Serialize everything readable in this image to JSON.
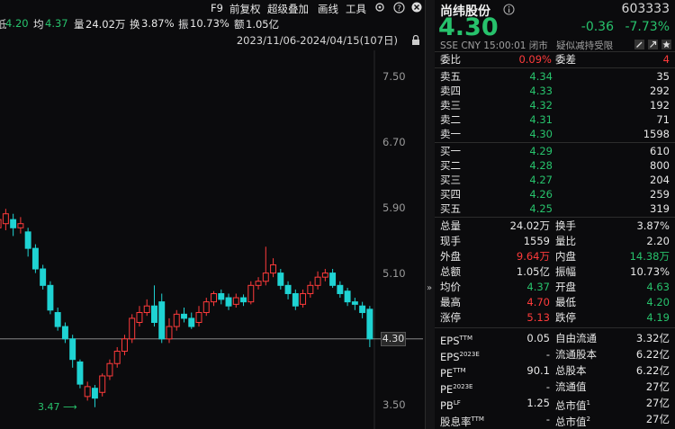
{
  "toolbar": {
    "f9": "F9",
    "adjust": "前复权",
    "overlay": "超级叠加",
    "draw": "画线",
    "tools": "工具",
    "settings_icon": "gear-icon",
    "help_icon": "help-icon",
    "close_icon": "close-icon"
  },
  "info": {
    "prefix": "低",
    "low": "4.20",
    "avg_label": "均",
    "avg": "4.37",
    "vol_label": "量",
    "vol": "24.02万",
    "turnover_label": "换",
    "turnover": "3.87%",
    "amp_label": "振",
    "amp": "10.73%",
    "amt_label": "额",
    "amt": "1.05亿"
  },
  "date_range": "2023/11/06-2024/04/15(107日)",
  "chart_data": {
    "type": "candlestick",
    "y_ticks": [
      "7.50",
      "6.70",
      "5.90",
      "5.10",
      "4.30",
      "3.50"
    ],
    "y_range": [
      3.5,
      7.5
    ],
    "current_price_tag": "4.30",
    "low_marker": "3.47",
    "candles": [
      {
        "o": 5.65,
        "c": 5.75,
        "h": 5.8,
        "l": 5.55
      },
      {
        "o": 5.7,
        "c": 5.82,
        "h": 5.88,
        "l": 5.62
      },
      {
        "o": 5.75,
        "c": 5.65,
        "h": 5.82,
        "l": 5.55
      },
      {
        "o": 5.65,
        "c": 5.7,
        "h": 5.78,
        "l": 5.58
      },
      {
        "o": 5.6,
        "c": 5.4,
        "h": 5.65,
        "l": 5.3
      },
      {
        "o": 5.4,
        "c": 5.15,
        "h": 5.45,
        "l": 5.1
      },
      {
        "o": 5.15,
        "c": 4.95,
        "h": 5.2,
        "l": 4.9
      },
      {
        "o": 4.95,
        "c": 4.65,
        "h": 5.0,
        "l": 4.6
      },
      {
        "o": 4.62,
        "c": 4.45,
        "h": 4.68,
        "l": 4.4
      },
      {
        "o": 4.45,
        "c": 4.3,
        "h": 4.5,
        "l": 4.25
      },
      {
        "o": 4.3,
        "c": 4.05,
        "h": 4.35,
        "l": 3.95
      },
      {
        "o": 4.02,
        "c": 3.75,
        "h": 4.05,
        "l": 3.7
      },
      {
        "o": 3.6,
        "c": 3.72,
        "h": 3.78,
        "l": 3.55
      },
      {
        "o": 3.7,
        "c": 3.58,
        "h": 3.74,
        "l": 3.47
      },
      {
        "o": 3.65,
        "c": 3.85,
        "h": 3.88,
        "l": 3.6
      },
      {
        "o": 3.85,
        "c": 4.0,
        "h": 4.05,
        "l": 3.8
      },
      {
        "o": 4.0,
        "c": 4.15,
        "h": 4.2,
        "l": 3.95
      },
      {
        "o": 4.15,
        "c": 4.3,
        "h": 4.35,
        "l": 4.1
      },
      {
        "o": 4.3,
        "c": 4.55,
        "h": 4.6,
        "l": 4.25
      },
      {
        "o": 4.5,
        "c": 4.62,
        "h": 4.7,
        "l": 4.45
      },
      {
        "o": 4.62,
        "c": 4.7,
        "h": 4.78,
        "l": 4.58
      },
      {
        "o": 4.7,
        "c": 4.5,
        "h": 4.95,
        "l": 4.45
      },
      {
        "o": 4.75,
        "c": 4.3,
        "h": 4.85,
        "l": 4.25
      },
      {
        "o": 4.3,
        "c": 4.45,
        "h": 4.55,
        "l": 4.25
      },
      {
        "o": 4.45,
        "c": 4.6,
        "h": 4.65,
        "l": 4.4
      },
      {
        "o": 4.6,
        "c": 4.55,
        "h": 4.68,
        "l": 4.5
      },
      {
        "o": 4.55,
        "c": 4.45,
        "h": 4.62,
        "l": 4.42
      },
      {
        "o": 4.5,
        "c": 4.62,
        "h": 4.7,
        "l": 4.45
      },
      {
        "o": 4.62,
        "c": 4.75,
        "h": 4.8,
        "l": 4.58
      },
      {
        "o": 4.75,
        "c": 4.85,
        "h": 4.88,
        "l": 4.7
      },
      {
        "o": 4.85,
        "c": 4.78,
        "h": 4.9,
        "l": 4.72
      },
      {
        "o": 4.8,
        "c": 4.7,
        "h": 4.85,
        "l": 4.65
      },
      {
        "o": 4.72,
        "c": 4.8,
        "h": 4.85,
        "l": 4.68
      },
      {
        "o": 4.8,
        "c": 4.75,
        "h": 4.84,
        "l": 4.7
      },
      {
        "o": 4.75,
        "c": 4.95,
        "h": 5.0,
        "l": 4.72
      },
      {
        "o": 4.95,
        "c": 5.0,
        "h": 5.05,
        "l": 4.9
      },
      {
        "o": 5.0,
        "c": 5.1,
        "h": 5.42,
        "l": 4.95
      },
      {
        "o": 5.1,
        "c": 5.2,
        "h": 5.28,
        "l": 5.05
      },
      {
        "o": 5.1,
        "c": 4.95,
        "h": 5.15,
        "l": 4.9
      },
      {
        "o": 4.95,
        "c": 4.85,
        "h": 5.0,
        "l": 4.78
      },
      {
        "o": 4.85,
        "c": 4.7,
        "h": 4.9,
        "l": 4.65
      },
      {
        "o": 4.72,
        "c": 4.85,
        "h": 4.9,
        "l": 4.68
      },
      {
        "o": 4.85,
        "c": 4.95,
        "h": 5.0,
        "l": 4.8
      },
      {
        "o": 4.95,
        "c": 5.05,
        "h": 5.12,
        "l": 4.9
      },
      {
        "o": 5.05,
        "c": 5.1,
        "h": 5.15,
        "l": 5.0
      },
      {
        "o": 5.1,
        "c": 4.95,
        "h": 5.15,
        "l": 4.92
      },
      {
        "o": 4.95,
        "c": 4.85,
        "h": 5.0,
        "l": 4.8
      },
      {
        "o": 4.88,
        "c": 4.75,
        "h": 4.92,
        "l": 4.7
      },
      {
        "o": 4.75,
        "c": 4.72,
        "h": 4.8,
        "l": 4.65
      },
      {
        "o": 4.7,
        "c": 4.62,
        "h": 4.75,
        "l": 4.55
      },
      {
        "o": 4.66,
        "c": 4.3,
        "h": 4.7,
        "l": 4.2
      }
    ]
  },
  "stock": {
    "name": "尚纬股份",
    "code": "603333",
    "price": "4.30",
    "change": "-0.36",
    "change_pct": "-7.73%",
    "exchange": "SSE",
    "currency": "CNY",
    "time": "15:00:01",
    "status": "闭市",
    "note": "疑似减持受限"
  },
  "order_book": {
    "ratio_label": "委比",
    "ratio": "0.09%",
    "diff_label": "委差",
    "diff": "4",
    "asks": [
      {
        "label": "卖五",
        "price": "4.34",
        "vol": "35"
      },
      {
        "label": "卖四",
        "price": "4.33",
        "vol": "292"
      },
      {
        "label": "卖三",
        "price": "4.32",
        "vol": "192"
      },
      {
        "label": "卖二",
        "price": "4.31",
        "vol": "71"
      },
      {
        "label": "卖一",
        "price": "4.30",
        "vol": "1598"
      }
    ],
    "bids": [
      {
        "label": "买一",
        "price": "4.29",
        "vol": "610"
      },
      {
        "label": "买二",
        "price": "4.28",
        "vol": "800"
      },
      {
        "label": "买三",
        "price": "4.27",
        "vol": "204"
      },
      {
        "label": "买四",
        "price": "4.26",
        "vol": "259"
      },
      {
        "label": "买五",
        "price": "4.25",
        "vol": "319"
      }
    ]
  },
  "stats": [
    {
      "a_label": "总量",
      "a_val": "24.02万",
      "a_color": "white",
      "b_label": "换手",
      "b_val": "3.87%",
      "b_color": "white"
    },
    {
      "a_label": "现手",
      "a_val": "1559",
      "a_color": "white",
      "b_label": "量比",
      "b_val": "2.20",
      "b_color": "white"
    },
    {
      "a_label": "外盘",
      "a_val": "9.64万",
      "a_color": "red",
      "b_label": "内盘",
      "b_val": "14.38万",
      "b_color": "green"
    },
    {
      "a_label": "总额",
      "a_val": "1.05亿",
      "a_color": "white",
      "b_label": "振幅",
      "b_val": "10.73%",
      "b_color": "white"
    },
    {
      "a_label": "均价",
      "a_val": "4.37",
      "a_color": "green",
      "b_label": "开盘",
      "b_val": "4.63",
      "b_color": "green"
    },
    {
      "a_label": "最高",
      "a_val": "4.70",
      "a_color": "red",
      "b_label": "最低",
      "b_val": "4.20",
      "b_color": "green"
    },
    {
      "a_label": "涨停",
      "a_val": "5.13",
      "a_color": "red",
      "b_label": "跌停",
      "b_val": "4.19",
      "b_color": "green"
    }
  ],
  "fundamentals": [
    {
      "a_label": "EPS",
      "a_sup": "TTM",
      "a_val": "0.05",
      "b_label": "自由流通",
      "b_sup": "",
      "b_val": "3.32亿"
    },
    {
      "a_label": "EPS",
      "a_sup": "2023E",
      "a_val": "-",
      "b_label": "流通股本",
      "b_sup": "",
      "b_val": "6.22亿"
    },
    {
      "a_label": "PE",
      "a_sup": "TTM",
      "a_val": "90.1",
      "b_label": "总股本",
      "b_sup": "",
      "b_val": "6.22亿"
    },
    {
      "a_label": "PE",
      "a_sup": "2023E",
      "a_val": "-",
      "b_label": "流通值",
      "b_sup": "",
      "b_val": "27亿"
    },
    {
      "a_label": "PB",
      "a_sup": "LF",
      "a_val": "1.25",
      "b_label": "总市值",
      "b_sup": "1",
      "b_val": "27亿"
    },
    {
      "a_label": "股息率",
      "a_sup": "TTM",
      "a_val": "-",
      "b_label": "总市值",
      "b_sup": "2",
      "b_val": "27亿"
    }
  ],
  "colors": {
    "up": "#ff3b3b",
    "down": "#1fd3d3",
    "green": "#27c26c",
    "bg": "#0b0b0d"
  }
}
